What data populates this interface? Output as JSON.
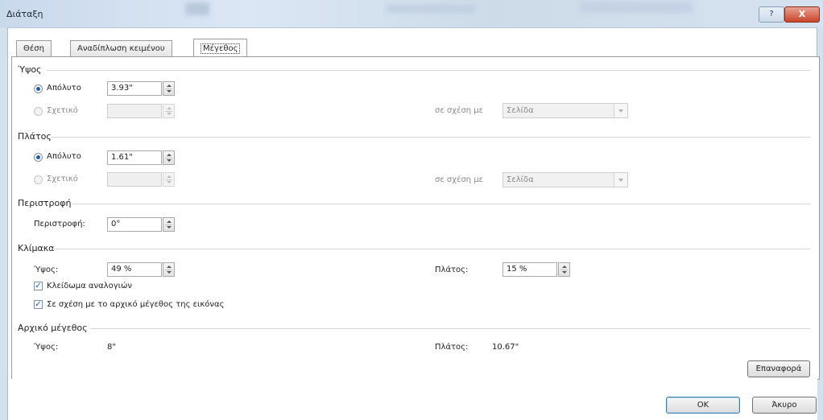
{
  "window": {
    "title": "Διάταξη",
    "help_label": "?",
    "close_label": "X"
  },
  "tabs": [
    {
      "label": "Θέση",
      "active": false
    },
    {
      "label": "Αναδίπλωση κειμένου",
      "active": false
    },
    {
      "label": "Μέγεθος",
      "active": true
    }
  ],
  "height": {
    "title": "Ύψος",
    "absolute_label": "Απόλυτο",
    "absolute_value": "3.93\"",
    "relative_label": "Σχετικό",
    "relative_value": "",
    "relative_to_label": "σε σχέση με",
    "relative_to_value": "Σελίδα"
  },
  "width": {
    "title": "Πλάτος",
    "absolute_label": "Απόλυτο",
    "absolute_value": "1.61\"",
    "relative_label": "Σχετικό",
    "relative_value": "",
    "relative_to_label": "σε σχέση με",
    "relative_to_value": "Σελίδα"
  },
  "rotation": {
    "title": "Περιστροφή",
    "label": "Περιστροφή:",
    "value": "0°"
  },
  "scale": {
    "title": "Κλίμακα",
    "height_label": "Ύψος:",
    "height_value": "49 %",
    "width_label": "Πλάτος:",
    "width_value": "15 %",
    "lock_aspect_label": "Κλείδωμα αναλογιών",
    "lock_aspect_checked": true,
    "relative_original_label": "Σε σχέση με το αρχικό μέγεθος της εικόνας",
    "relative_original_checked": true
  },
  "original_size": {
    "title": "Αρχικό μέγεθος",
    "height_label": "Ύψος:",
    "height_value": "8\"",
    "width_label": "Πλάτος:",
    "width_value": "10.67\""
  },
  "buttons": {
    "reset": "Επαναφορά",
    "ok": "ΟΚ",
    "cancel": "Άκυρο"
  }
}
